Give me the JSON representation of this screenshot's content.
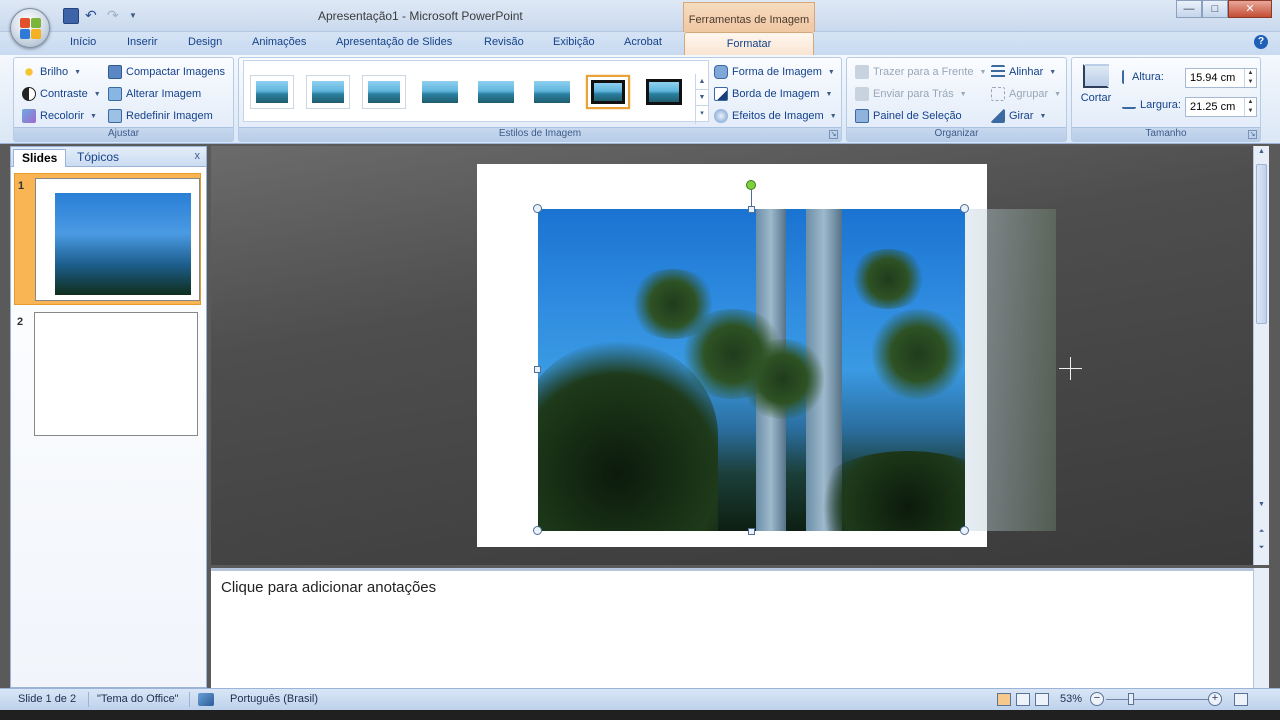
{
  "window": {
    "title": "Apresentação1 - Microsoft PowerPoint",
    "context_title": "Ferramentas de Imagem",
    "minimize": "—",
    "maximize": "□",
    "close": "✕"
  },
  "tabs": [
    "Início",
    "Inserir",
    "Design",
    "Animações",
    "Apresentação de Slides",
    "Revisão",
    "Exibição",
    "Acrobat"
  ],
  "active_tab": "Formatar",
  "help": "?",
  "ribbon": {
    "ajustar": {
      "label": "Ajustar",
      "brilho": "Brilho",
      "contraste": "Contraste",
      "recolorir": "Recolorir",
      "compactar": "Compactar Imagens",
      "alterar": "Alterar Imagem",
      "redefinir": "Redefinir Imagem"
    },
    "estilos": {
      "label": "Estilos de Imagem",
      "forma": "Forma de Imagem",
      "borda": "Borda de Imagem",
      "efeitos": "Efeitos de Imagem"
    },
    "organizar": {
      "label": "Organizar",
      "trazer": "Trazer para a Frente",
      "enviar": "Enviar para Trás",
      "painel": "Painel de Seleção",
      "alinhar": "Alinhar",
      "agrupar": "Agrupar",
      "girar": "Girar"
    },
    "tamanho": {
      "label": "Tamanho",
      "cortar": "Cortar",
      "altura_label": "Altura:",
      "altura_value": "15.94 cm",
      "largura_label": "Largura:",
      "largura_value": "21.25 cm"
    }
  },
  "panel": {
    "tab_slides": "Slides",
    "tab_topicos": "Tópicos",
    "close": "x",
    "slide_numbers": [
      "1",
      "2"
    ]
  },
  "notes": {
    "placeholder": "Clique para adicionar anotações"
  },
  "status": {
    "slide": "Slide 1 de 2",
    "theme": "\"Tema do Office\"",
    "language": "Português (Brasil)",
    "zoom": "53%",
    "zoom_minus": "−",
    "zoom_plus": "+"
  },
  "colors": {
    "accent": "#15428b",
    "context_tab": "#f0c7a3",
    "selected_slide": "#f9b554"
  }
}
